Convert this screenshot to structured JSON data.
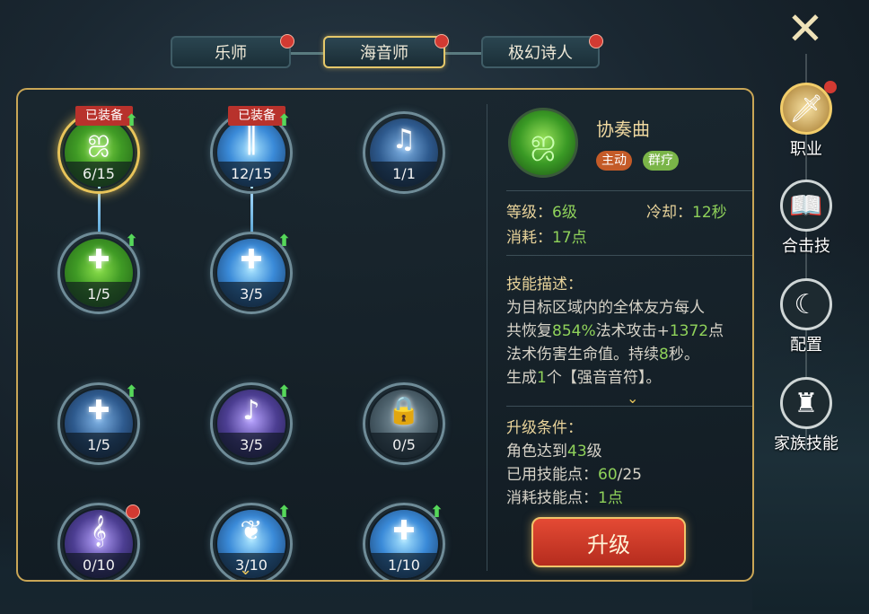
{
  "tabs": [
    {
      "label": "乐师",
      "active": false,
      "has_dot": true
    },
    {
      "label": "海音师",
      "active": true,
      "has_dot": true
    },
    {
      "label": "极幻诗人",
      "active": false,
      "has_dot": true
    }
  ],
  "skills": [
    {
      "level": "6/15",
      "badge": "已装备",
      "upgradable": true,
      "icon": "green-swirl-icon"
    },
    {
      "level": "12/15",
      "badge": "已装备",
      "upgradable": true,
      "icon": "blue-pillar-icon"
    },
    {
      "level": "1/1",
      "icon": "music-notes-icon"
    },
    {
      "level": "1/5",
      "upgradable": true,
      "icon": "green-heal-icon"
    },
    {
      "level": "3/5",
      "upgradable": true,
      "icon": "blue-heal-icon"
    },
    {
      "level": "1/5",
      "upgradable": true,
      "icon": "figure-heal-icon"
    },
    {
      "level": "3/5",
      "upgradable": true,
      "icon": "note-swirl-icon"
    },
    {
      "level": "0/5",
      "icon": "locked-note-icon"
    },
    {
      "level": "0/10",
      "has_dot": true,
      "icon": "treble-clef-icon"
    },
    {
      "level": "3/10",
      "upgradable": true,
      "icon": "wings-icon"
    },
    {
      "level": "1/10",
      "upgradable": true,
      "icon": "double-heal-icon"
    }
  ],
  "detail": {
    "name": "协奏曲",
    "tag_active": "主动",
    "tag_type": "群疗",
    "level_label": "等级：",
    "level_value": "6级",
    "cooldown_label": "冷却：",
    "cooldown_value": "12秒",
    "cost_label": "消耗：",
    "cost_value": "17点",
    "desc_title": "技能描述：",
    "desc_1": "为目标区域内的全体友方每人",
    "desc_2a": "共恢复",
    "desc_2b": "854%",
    "desc_2c": "法术攻击+",
    "desc_2d": "1372",
    "desc_2e": "点",
    "desc_3a": "法术伤害生命值。持续",
    "desc_3b": "8",
    "desc_3c": "秒。",
    "desc_4a": "生成",
    "desc_4b": "1",
    "desc_4c": "个【强音音符】。",
    "cond_title": "升级条件：",
    "cond_1a": "角色达到",
    "cond_1b": "43",
    "cond_1c": "级",
    "cond_2a": "已用技能点：",
    "cond_2b": "60",
    "cond_2c": "/25",
    "cond_3a": "消耗技能点：",
    "cond_3b": "1点",
    "upgrade_label": "升级"
  },
  "side_menu": [
    {
      "label": "职业",
      "icon": "sword-icon",
      "active": true,
      "has_dot": true
    },
    {
      "label": "合击技",
      "icon": "book-icon"
    },
    {
      "label": "配置",
      "icon": "moon-star-icon"
    },
    {
      "label": "家族技能",
      "icon": "family-crest-icon"
    }
  ],
  "colors": {
    "accent_gold": "#e8c45a",
    "value_green": "#8fd25a",
    "upgrade_red": "#d23a32"
  }
}
